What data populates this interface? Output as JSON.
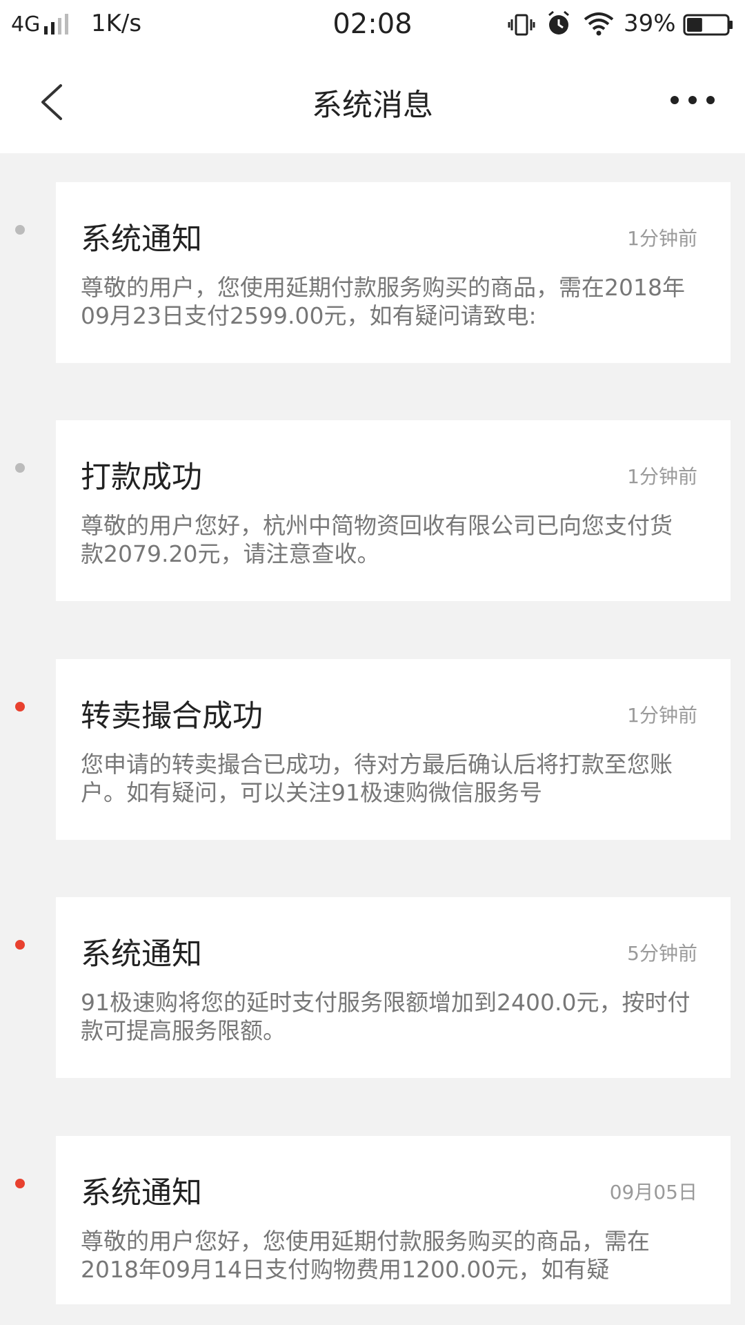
{
  "status_bar": {
    "network": "4G",
    "speed": "1K/s",
    "time": "02:08",
    "battery_percent": "39%",
    "battery_level": 0.39,
    "icons": [
      "signal-icon",
      "vibrate-icon",
      "alarm-icon",
      "wifi-icon",
      "battery-icon"
    ]
  },
  "header": {
    "title": "系统消息",
    "back_icon": "chevron-left-icon",
    "more_icon": "more-dots-icon"
  },
  "colors": {
    "unread_dot": "#e8412f",
    "read_dot": "#bbbbbb",
    "background": "#f2f2f2",
    "card": "#ffffff"
  },
  "messages": [
    {
      "title": "系统通知",
      "time": "1分钟前",
      "body": "尊敬的用户，您使用延期付款服务购买的商品，需在2018年09月23日支付2599.00元，如有疑问请致电:",
      "unread": false
    },
    {
      "title": "打款成功",
      "time": "1分钟前",
      "body": "尊敬的用户您好，杭州中简物资回收有限公司已向您支付货款2079.20元，请注意查收。",
      "unread": false
    },
    {
      "title": "转卖撮合成功",
      "time": "1分钟前",
      "body": "您申请的转卖撮合已成功，待对方最后确认后将打款至您账户。如有疑问，可以关注91极速购微信服务号",
      "unread": true
    },
    {
      "title": "系统通知",
      "time": "5分钟前",
      "body": "91极速购将您的延时支付服务限额增加到2400.0元，按时付款可提高服务限额。",
      "unread": true
    },
    {
      "title": "系统通知",
      "time": "09月05日",
      "body": "尊敬的用户您好，您使用延期付款服务购买的商品，需在2018年09月14日支付购物费用1200.00元，如有疑",
      "unread": true
    }
  ]
}
